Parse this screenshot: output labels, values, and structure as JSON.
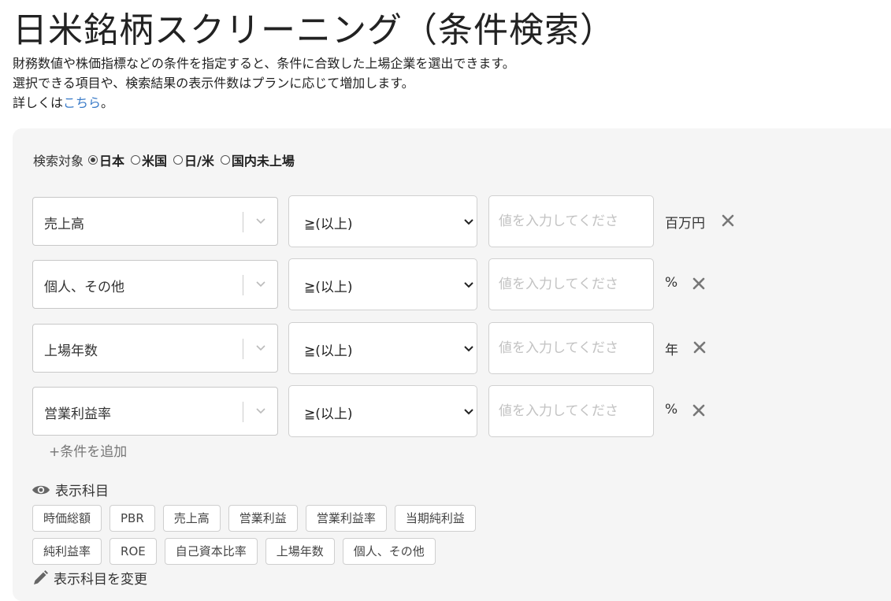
{
  "page": {
    "title": "日米銘柄スクリーニング（条件検索）",
    "desc_line1": "財務数値や株価指標などの条件を指定すると、条件に合致した上場企業を選出できます。",
    "desc_line2": "選択できる項目や、検索結果の表示件数はプランに応じて増加します。",
    "desc_line3_prefix": "詳しくは",
    "desc_line3_link": "こちら",
    "desc_line3_suffix": "。"
  },
  "search_target": {
    "label": "検索対象",
    "options": [
      {
        "label": "日本",
        "checked": true
      },
      {
        "label": "米国",
        "checked": false
      },
      {
        "label": "日/米",
        "checked": false
      },
      {
        "label": "国内未上場",
        "checked": false
      }
    ]
  },
  "conditions": [
    {
      "field": "売上高",
      "operator": "≧(以上)",
      "value": "",
      "placeholder": "値を入力してくださ",
      "unit": "百万円"
    },
    {
      "field": "個人、その他",
      "operator": "≧(以上)",
      "value": "",
      "placeholder": "値を入力してくださ",
      "unit": "%"
    },
    {
      "field": "上場年数",
      "operator": "≧(以上)",
      "value": "",
      "placeholder": "値を入力してくださ",
      "unit": "年"
    },
    {
      "field": "営業利益率",
      "operator": "≧(以上)",
      "value": "",
      "placeholder": "値を入力してくださ",
      "unit": "%"
    }
  ],
  "add_condition_label": "+条件を追加",
  "display_items": {
    "heading": "表示科目",
    "row1": [
      "時価総額",
      "PBR",
      "売上高",
      "営業利益",
      "営業利益率",
      "当期純利益"
    ],
    "row2": [
      "純利益率",
      "ROE",
      "自己資本比率",
      "上場年数",
      "個人、その他"
    ],
    "change_label": "表示科目を変更"
  },
  "colors": {
    "link": "#3a7bc8",
    "panel_bg": "#f5f5f5",
    "remove_icon": "#777777"
  }
}
